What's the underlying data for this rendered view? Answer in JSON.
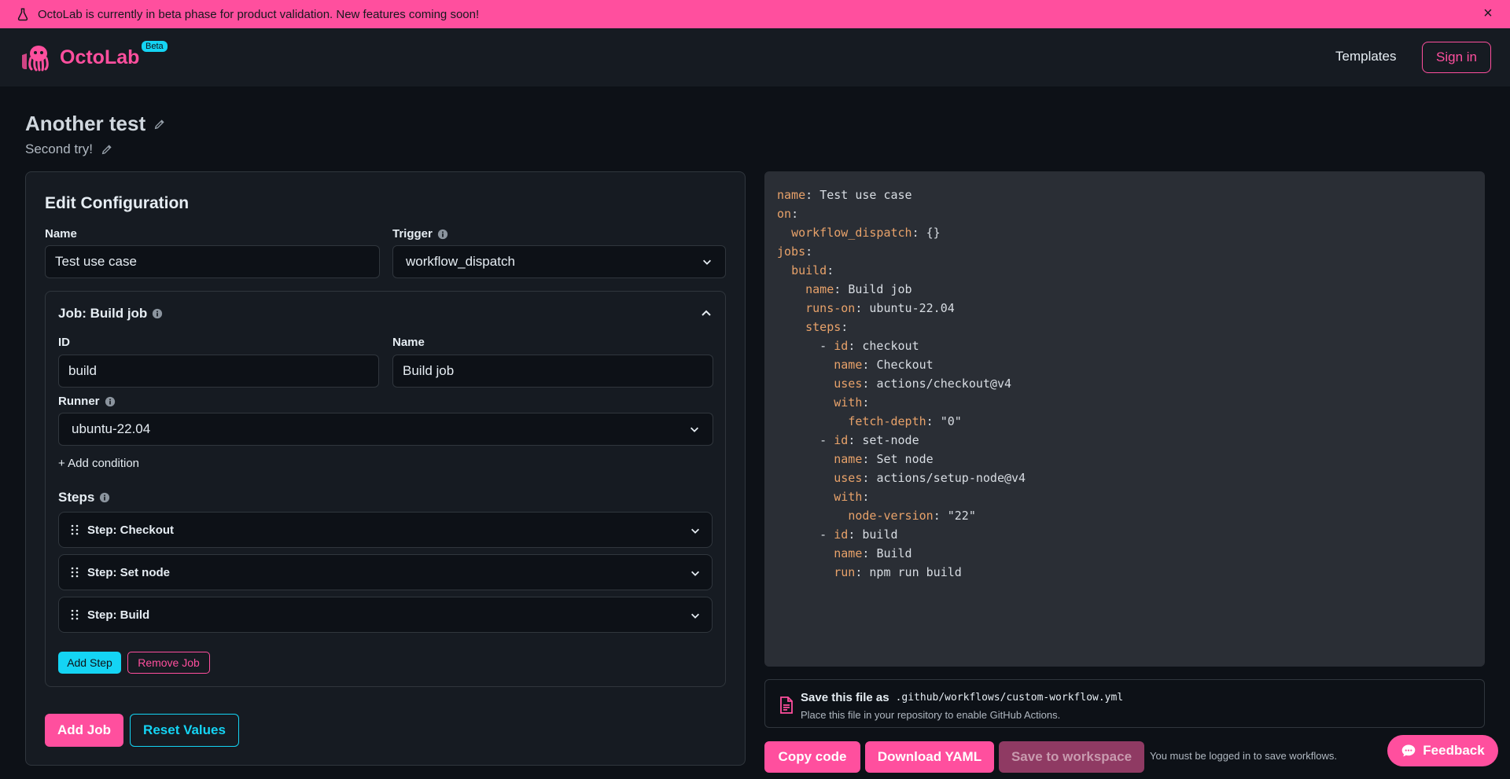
{
  "banner": {
    "text": "OctoLab is currently in beta phase for product validation. New features coming soon!"
  },
  "header": {
    "brand": "OctoLab",
    "badge": "Beta",
    "templates": "Templates",
    "signin": "Sign in"
  },
  "workflow": {
    "title": "Another test",
    "description": "Second try!"
  },
  "config": {
    "title": "Edit Configuration",
    "name_label": "Name",
    "name_value": "Test use case",
    "trigger_label": "Trigger",
    "trigger_value": "workflow_dispatch",
    "job": {
      "title": "Job: Build job",
      "id_label": "ID",
      "id_value": "build",
      "name_label": "Name",
      "name_value": "Build job",
      "runner_label": "Runner",
      "runner_value": "ubuntu-22.04",
      "add_condition": "+ Add condition",
      "steps_label": "Steps",
      "steps": [
        {
          "label": "Step: Checkout"
        },
        {
          "label": "Step: Set node"
        },
        {
          "label": "Step: Build"
        }
      ],
      "add_step": "Add Step",
      "remove_job": "Remove Job"
    },
    "add_job": "Add Job",
    "reset_values": "Reset Values"
  },
  "yaml_lines": [
    {
      "indent": "",
      "key": "name",
      "value": "Test use case"
    },
    {
      "indent": "",
      "key": "on",
      "value": ""
    },
    {
      "indent": "  ",
      "key": "workflow_dispatch",
      "value": "{}"
    },
    {
      "indent": "",
      "key": "jobs",
      "value": ""
    },
    {
      "indent": "  ",
      "key": "build",
      "value": ""
    },
    {
      "indent": "    ",
      "key": "name",
      "value": "Build job"
    },
    {
      "indent": "    ",
      "key": "runs-on",
      "value": "ubuntu-22.04"
    },
    {
      "indent": "    ",
      "key": "steps",
      "value": ""
    },
    {
      "indent": "      - ",
      "key": "id",
      "value": "checkout"
    },
    {
      "indent": "        ",
      "key": "name",
      "value": "Checkout"
    },
    {
      "indent": "        ",
      "key": "uses",
      "value": "actions/checkout@v4"
    },
    {
      "indent": "        ",
      "key": "with",
      "value": ""
    },
    {
      "indent": "          ",
      "key": "fetch-depth",
      "value": "\"0\""
    },
    {
      "indent": "      - ",
      "key": "id",
      "value": "set-node"
    },
    {
      "indent": "        ",
      "key": "name",
      "value": "Set node"
    },
    {
      "indent": "        ",
      "key": "uses",
      "value": "actions/setup-node@v4"
    },
    {
      "indent": "        ",
      "key": "with",
      "value": ""
    },
    {
      "indent": "          ",
      "key": "node-version",
      "value": "\"22\""
    },
    {
      "indent": "      - ",
      "key": "id",
      "value": "build"
    },
    {
      "indent": "        ",
      "key": "name",
      "value": "Build"
    },
    {
      "indent": "        ",
      "key": "run",
      "value": "npm run build"
    }
  ],
  "save": {
    "title": "Save this file as",
    "path": ".github/workflows/custom-workflow.yml",
    "hint": "Place this file in your repository to enable GitHub Actions."
  },
  "actions": {
    "copy": "Copy code",
    "download": "Download YAML",
    "save_workspace": "Save to workspace",
    "login_note": "You must be logged in to save workflows."
  },
  "feedback": "Feedback",
  "colors": {
    "accent_pink": "#ff4f9e",
    "accent_cyan": "#14d4f4",
    "background": "#0d1117",
    "panel": "#161b22",
    "yaml_key": "#e8a26a"
  }
}
